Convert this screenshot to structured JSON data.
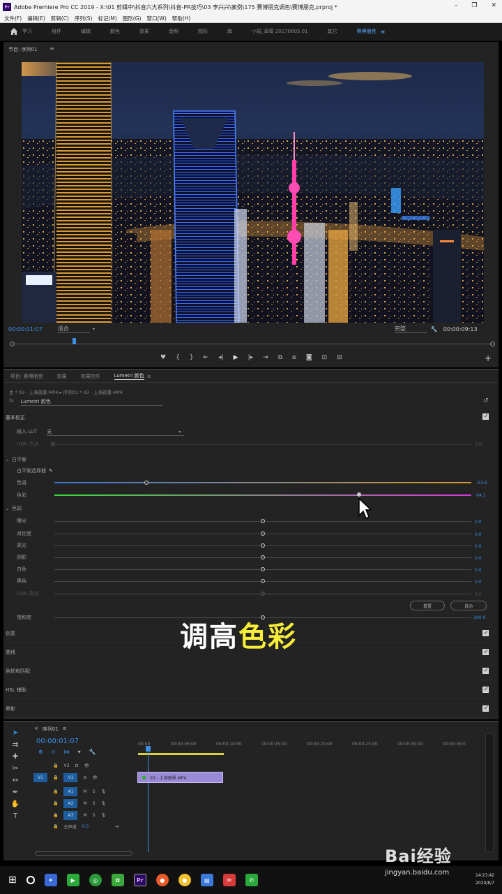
{
  "app": {
    "title": "Adobe Premiere Pro CC 2019 - X:\\01 剪辑中\\抖音六大系列\\抖音-PR技巧\\03 李兴兴\\案例\\175 赛博朋克调色\\赛博朋克.prproj *",
    "icon_text": "Pr",
    "win_controls": [
      "–",
      "❐",
      "✕"
    ]
  },
  "menu": [
    "文件(F)",
    "编辑(E)",
    "剪辑(C)",
    "序列(S)",
    "标记(M)",
    "图形(G)",
    "窗口(W)",
    "帮助(H)"
  ],
  "workspaces": [
    {
      "label": "学习",
      "active": false
    },
    {
      "label": "组件",
      "active": false
    },
    {
      "label": "编辑",
      "active": false
    },
    {
      "label": "颜色",
      "active": false
    },
    {
      "label": "效果",
      "active": false
    },
    {
      "label": "音频",
      "active": false
    },
    {
      "label": "图形",
      "active": false
    },
    {
      "label": "库",
      "active": false
    },
    {
      "label": "小娟_草莓 20170605.01",
      "active": false
    },
    {
      "label": "其它",
      "active": false
    },
    {
      "label": "赛博朋克",
      "active": true
    }
  ],
  "program": {
    "title": "节目: 序列01",
    "timecode": "00:00:01:07",
    "fit": "适合",
    "quality": "完整",
    "duration": "00:00:09:13"
  },
  "lumetri": {
    "tabs": [
      {
        "label": "项目: 赛博朋克",
        "active": false
      },
      {
        "label": "效果",
        "active": false
      },
      {
        "label": "效果控件",
        "active": false
      },
      {
        "label": "Lumetri 颜色",
        "active": true
      }
    ],
    "clip_path": "主 * 03 - 上海夜景.MP4 ▸ 序列01 * 03 - 上海夜景.MP4",
    "effect": "Lumetri 颜色",
    "basic_correction": "基本校正",
    "lut_label": "输入 LUT",
    "lut_value": "无",
    "hdr_white": "HDR 白点",
    "hdr_white_value": "100",
    "white_balance": "白平衡",
    "wb_picker": "白平衡选择器",
    "temperature": {
      "label": "色温",
      "value": "-53.6",
      "fraction": 0.22
    },
    "tint": {
      "label": "色彩",
      "value": "64.1",
      "fraction": 0.73
    },
    "tone": "色调",
    "tone_rows": [
      {
        "label": "曝光",
        "value": "0.0"
      },
      {
        "label": "对比度",
        "value": "0.0"
      },
      {
        "label": "高光",
        "value": "0.0"
      },
      {
        "label": "阴影",
        "value": "0.0"
      },
      {
        "label": "白色",
        "value": "0.0"
      },
      {
        "label": "黑色",
        "value": "0.0"
      },
      {
        "label": "HDR 高光",
        "value": "0.0"
      }
    ],
    "reset_btn": "重置",
    "auto_btn": "自动",
    "saturation": {
      "label": "饱和度",
      "value": "100.0"
    },
    "sections": [
      "创意",
      "曲线",
      "色轮和匹配",
      "HSL 辅助",
      "晕影"
    ]
  },
  "caption": {
    "white": "调高",
    "yellow": "色彩"
  },
  "timeline": {
    "title": "序列01",
    "timecode": "00:00:01:07",
    "ruler": [
      "00:00",
      "00:00:05:00",
      "00:00:10:00",
      "00:00:15:00",
      "00:00:20:00",
      "00:00:25:00",
      "00:00:30:00",
      "00:00:35:0"
    ],
    "video_tracks": [
      "V3",
      "V2",
      "V1"
    ],
    "audio_tracks": [
      "A1",
      "A2",
      "A3"
    ],
    "master": "主声道",
    "master_value": "0.0",
    "clip_label": "03 - 上海夜景.MP4",
    "src": "V1"
  },
  "taskbar": {
    "clock": "14:23:42",
    "date": "2020/8/7"
  },
  "watermark": {
    "text": "Bai经验",
    "url": "jingyan.baidu.com"
  }
}
